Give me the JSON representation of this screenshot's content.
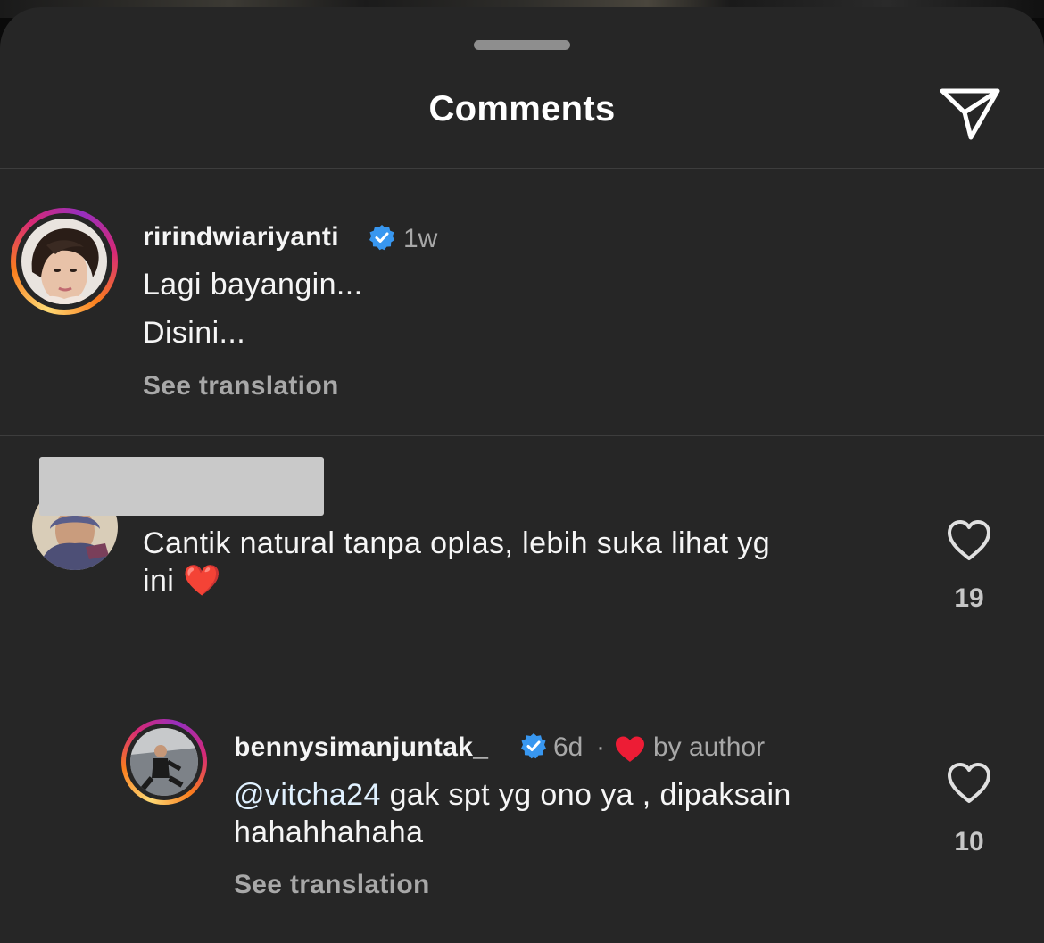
{
  "header": {
    "title": "Comments",
    "send_icon": "paper-plane-icon"
  },
  "comments": [
    {
      "username": "ririndwiariyanti",
      "verified": true,
      "time": "1w",
      "lines": [
        "Lagi bayangin...",
        "Disini..."
      ],
      "see_translation": "See translation",
      "avatar_ring": true
    },
    {
      "username": "",
      "username_redacted": true,
      "lines": [
        "Cantik natural tanpa oplas, lebih suka lihat yg",
        "ini"
      ],
      "emoji": "❤️",
      "likes": "19",
      "like_icon": "heart-outline-icon"
    },
    {
      "reply": true,
      "username": "bennysimanjuntak_",
      "verified": true,
      "time": "6d",
      "separator": "·",
      "liked_by_author": "by author",
      "mention": "@vitcha24",
      "lines": [
        " gak spt yg ono ya , dipaksain",
        "hahahhahaha"
      ],
      "see_translation": "See translation",
      "likes": "10",
      "like_icon": "heart-outline-icon",
      "avatar_ring": true
    }
  ],
  "colors": {
    "sheet_bg": "#262626",
    "verified_blue": "#3897f0",
    "heart_red": "#ed1c35",
    "secondary_text": "#a8a8a8"
  }
}
